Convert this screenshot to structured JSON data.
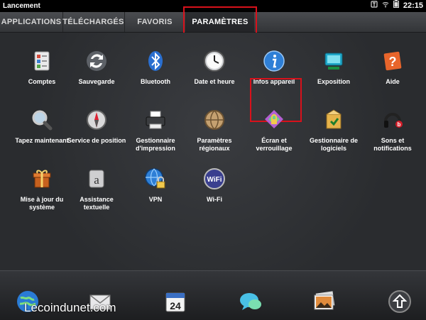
{
  "status": {
    "title": "Lancement",
    "time": "22:15"
  },
  "tabs": [
    {
      "label": "APPLICATIONS"
    },
    {
      "label": "TÉLÉCHARGÉS"
    },
    {
      "label": "FAVORIS"
    },
    {
      "label": "PARAMÈTRES"
    }
  ],
  "apps": [
    {
      "label": "Comptes",
      "icon": "accounts-icon"
    },
    {
      "label": "Sauvegarde",
      "icon": "backup-icon"
    },
    {
      "label": "Bluetooth",
      "icon": "bluetooth-icon"
    },
    {
      "label": "Date et heure",
      "icon": "clock-icon"
    },
    {
      "label": "Infos appareil",
      "icon": "info-icon"
    },
    {
      "label": "Exposition",
      "icon": "exhibition-icon"
    },
    {
      "label": "Aide",
      "icon": "help-icon"
    },
    {
      "label": "Tapez maintenant",
      "icon": "magnifier-icon"
    },
    {
      "label": "Service de position",
      "icon": "compass-icon"
    },
    {
      "label": "Gestionnaire d'impression",
      "icon": "printer-icon"
    },
    {
      "label": "Paramètres régionaux",
      "icon": "globe-icon"
    },
    {
      "label": "Écran et verrouillage",
      "icon": "screen-lock-icon"
    },
    {
      "label": "Gestionnaire de logiciels",
      "icon": "software-manager-icon"
    },
    {
      "label": "Sons et notifications",
      "icon": "sound-icon"
    },
    {
      "label": "Mise à jour du système",
      "icon": "gift-update-icon"
    },
    {
      "label": "Assistance textuelle",
      "icon": "text-assist-icon"
    },
    {
      "label": "VPN",
      "icon": "vpn-icon"
    },
    {
      "label": "Wi-Fi",
      "icon": "wifi-icon"
    }
  ],
  "dock": [
    {
      "icon": "browser-globe-icon"
    },
    {
      "icon": "email-icon"
    },
    {
      "icon": "calendar-icon",
      "text": "24"
    },
    {
      "icon": "messaging-icon"
    },
    {
      "icon": "photos-icon"
    },
    {
      "icon": "launcher-up-icon"
    }
  ],
  "watermark": "Lecoindunet.com",
  "colors": {
    "highlight": "#d8111b"
  }
}
